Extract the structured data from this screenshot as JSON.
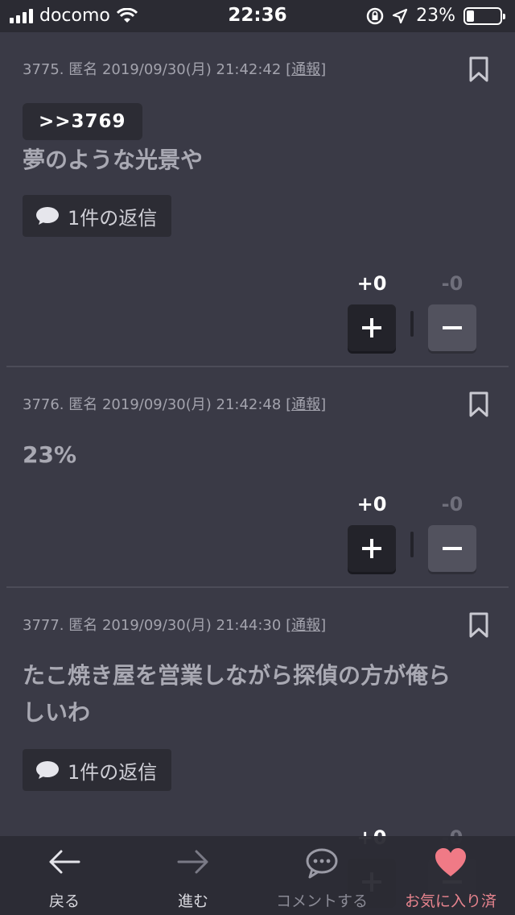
{
  "status_bar": {
    "carrier": "docomo",
    "time": "22:36",
    "battery_text": "23%",
    "battery_level": 0.23
  },
  "posts": [
    {
      "meta": "3775. 匿名 2019/09/30(月) 21:42:42",
      "report_open": "[",
      "report_label": "通報",
      "report_close": "]",
      "quote": ">>3769",
      "text": "夢のような光景や",
      "reply_label": "1件の返信",
      "plus_count": "+0",
      "minus_count": "-0"
    },
    {
      "meta": "3776. 匿名 2019/09/30(月) 21:42:48",
      "report_open": "[",
      "report_label": "通報",
      "report_close": "]",
      "text": "23%",
      "plus_count": "+0",
      "minus_count": "-0"
    },
    {
      "meta": "3777. 匿名 2019/09/30(月) 21:44:30",
      "report_open": "[",
      "report_label": "通報",
      "report_close": "]",
      "text_line1": "たこ焼き屋を営業しながら探偵の方が俺ら",
      "text_line2": "しいわ",
      "reply_label": "1件の返信",
      "plus_count": "+0",
      "minus_count": "-0"
    }
  ],
  "toolbar": {
    "back_label": "戻る",
    "forward_label": "進む",
    "comment_label": "コメントする",
    "favorite_label": "お気に入り済"
  },
  "colors": {
    "background": "#3a3a46",
    "favorite_accent": "#f07a86"
  }
}
